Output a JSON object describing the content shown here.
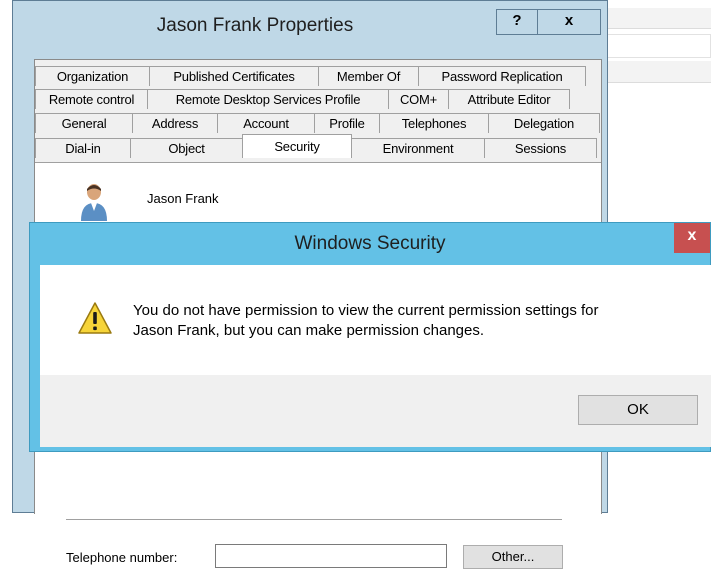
{
  "properties": {
    "title": "Jason Frank Properties",
    "help_label": "?",
    "close_label": "x",
    "tab_rows": [
      [
        "Organization",
        "Published Certificates",
        "Member Of",
        "Password Replication"
      ],
      [
        "Remote control",
        "Remote Desktop Services Profile",
        "COM+",
        "Attribute Editor"
      ],
      [
        "General",
        "Address",
        "Account",
        "Profile",
        "Telephones",
        "Delegation"
      ],
      [
        "Dial-in",
        "Object",
        "Security",
        "Environment",
        "Sessions"
      ]
    ],
    "active_tab": "Security",
    "user_name": "Jason Frank",
    "telephone_label": "Telephone number:",
    "telephone_value": "",
    "other_label": "Other..."
  },
  "security_dialog": {
    "title": "Windows Security",
    "close_label": "x",
    "message_line1": "You do not have permission to view the current permission settings for",
    "message_line2": "Jason Frank, but you can make permission changes.",
    "ok_label": "OK",
    "icon": "warning-icon"
  },
  "colors": {
    "props_frame": "#bfd8e7",
    "security_frame": "#63c1e6",
    "close_red": "#c75050"
  }
}
